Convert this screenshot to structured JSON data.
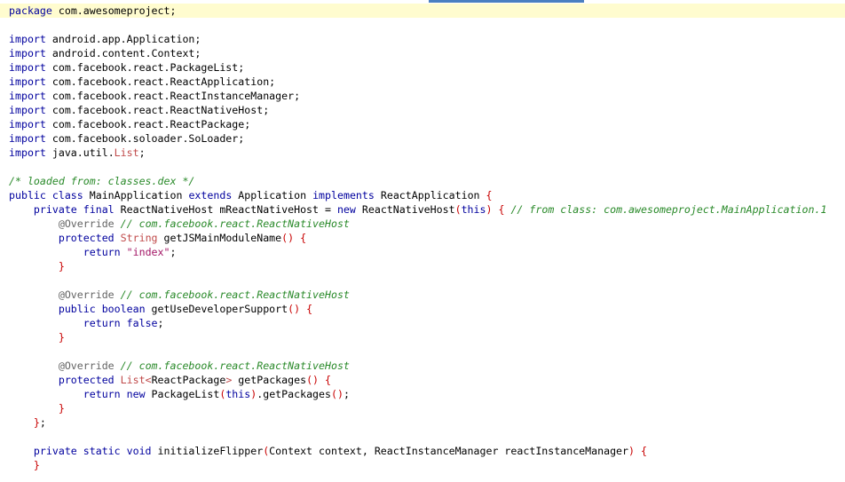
{
  "editor": {
    "lines": [
      {
        "hl": true,
        "tokens": [
          [
            "kw",
            "package"
          ],
          [
            "p",
            " com.awesomeproject;"
          ]
        ]
      },
      {
        "tokens": []
      },
      {
        "tokens": [
          [
            "kw",
            "import"
          ],
          [
            "p",
            " android.app.Application;"
          ]
        ]
      },
      {
        "tokens": [
          [
            "kw",
            "import"
          ],
          [
            "p",
            " android.content.Context;"
          ]
        ]
      },
      {
        "tokens": [
          [
            "kw",
            "import"
          ],
          [
            "p",
            " com.facebook.react.PackageList;"
          ]
        ]
      },
      {
        "tokens": [
          [
            "kw",
            "import"
          ],
          [
            "p",
            " com.facebook.react.ReactApplication;"
          ]
        ]
      },
      {
        "tokens": [
          [
            "kw",
            "import"
          ],
          [
            "p",
            " com.facebook.react.ReactInstanceManager;"
          ]
        ]
      },
      {
        "tokens": [
          [
            "kw",
            "import"
          ],
          [
            "p",
            " com.facebook.react.ReactNativeHost;"
          ]
        ]
      },
      {
        "tokens": [
          [
            "kw",
            "import"
          ],
          [
            "p",
            " com.facebook.react.ReactPackage;"
          ]
        ]
      },
      {
        "tokens": [
          [
            "kw",
            "import"
          ],
          [
            "p",
            " com.facebook.soloader.SoLoader;"
          ]
        ]
      },
      {
        "tokens": [
          [
            "kw",
            "import"
          ],
          [
            "p",
            " java.util."
          ],
          [
            "ty",
            "List"
          ],
          [
            "p",
            ";"
          ]
        ]
      },
      {
        "tokens": []
      },
      {
        "tokens": [
          [
            "cm",
            "/* loaded from: classes.dex */"
          ]
        ]
      },
      {
        "tokens": [
          [
            "kw",
            "public class"
          ],
          [
            "p",
            " MainApplication "
          ],
          [
            "kw",
            "extends"
          ],
          [
            "p",
            " Application "
          ],
          [
            "kw",
            "implements"
          ],
          [
            "p",
            " ReactApplication "
          ],
          [
            "br",
            "{"
          ]
        ]
      },
      {
        "tokens": [
          [
            "p",
            "    "
          ],
          [
            "kw",
            "private final"
          ],
          [
            "p",
            " ReactNativeHost mReactNativeHost = "
          ],
          [
            "kw",
            "new"
          ],
          [
            "p",
            " ReactNativeHost"
          ],
          [
            "br",
            "("
          ],
          [
            "kw",
            "this"
          ],
          [
            "br",
            ")"
          ],
          [
            "p",
            " "
          ],
          [
            "br",
            "{"
          ],
          [
            "p",
            " "
          ],
          [
            "cm",
            "// from class: com.awesomeproject.MainApplication.1"
          ]
        ]
      },
      {
        "tokens": [
          [
            "p",
            "        "
          ],
          [
            "an",
            "@Override"
          ],
          [
            "p",
            " "
          ],
          [
            "cm",
            "// com.facebook.react.ReactNativeHost"
          ]
        ]
      },
      {
        "tokens": [
          [
            "p",
            "        "
          ],
          [
            "kw",
            "protected"
          ],
          [
            "p",
            " "
          ],
          [
            "ty",
            "String"
          ],
          [
            "p",
            " getJSMainModuleName"
          ],
          [
            "br",
            "()"
          ],
          [
            "p",
            " "
          ],
          [
            "br",
            "{"
          ]
        ]
      },
      {
        "tokens": [
          [
            "p",
            "            "
          ],
          [
            "kw",
            "return"
          ],
          [
            "p",
            " "
          ],
          [
            "st",
            "\"index\""
          ],
          [
            "p",
            ";"
          ]
        ]
      },
      {
        "tokens": [
          [
            "p",
            "        "
          ],
          [
            "br",
            "}"
          ]
        ]
      },
      {
        "tokens": []
      },
      {
        "tokens": [
          [
            "p",
            "        "
          ],
          [
            "an",
            "@Override"
          ],
          [
            "p",
            " "
          ],
          [
            "cm",
            "// com.facebook.react.ReactNativeHost"
          ]
        ]
      },
      {
        "tokens": [
          [
            "p",
            "        "
          ],
          [
            "kw",
            "public boolean"
          ],
          [
            "p",
            " getUseDeveloperSupport"
          ],
          [
            "br",
            "()"
          ],
          [
            "p",
            " "
          ],
          [
            "br",
            "{"
          ]
        ]
      },
      {
        "tokens": [
          [
            "p",
            "            "
          ],
          [
            "kw",
            "return false"
          ],
          [
            "p",
            ";"
          ]
        ]
      },
      {
        "tokens": [
          [
            "p",
            "        "
          ],
          [
            "br",
            "}"
          ]
        ]
      },
      {
        "tokens": []
      },
      {
        "tokens": [
          [
            "p",
            "        "
          ],
          [
            "an",
            "@Override"
          ],
          [
            "p",
            " "
          ],
          [
            "cm",
            "// com.facebook.react.ReactNativeHost"
          ]
        ]
      },
      {
        "tokens": [
          [
            "p",
            "        "
          ],
          [
            "kw",
            "protected"
          ],
          [
            "p",
            " "
          ],
          [
            "ty",
            "List"
          ],
          [
            "ge",
            "<"
          ],
          [
            "p",
            "ReactPackage"
          ],
          [
            "ge",
            ">"
          ],
          [
            "p",
            " getPackages"
          ],
          [
            "br",
            "()"
          ],
          [
            "p",
            " "
          ],
          [
            "br",
            "{"
          ]
        ]
      },
      {
        "tokens": [
          [
            "p",
            "            "
          ],
          [
            "kw",
            "return new"
          ],
          [
            "p",
            " PackageList"
          ],
          [
            "br",
            "("
          ],
          [
            "kw",
            "this"
          ],
          [
            "br",
            ")"
          ],
          [
            "p",
            ".getPackages"
          ],
          [
            "br",
            "()"
          ],
          [
            "p",
            ";"
          ]
        ]
      },
      {
        "tokens": [
          [
            "p",
            "        "
          ],
          [
            "br",
            "}"
          ]
        ]
      },
      {
        "tokens": [
          [
            "p",
            "    "
          ],
          [
            "br",
            "}"
          ],
          [
            "p",
            ";"
          ]
        ]
      },
      {
        "tokens": []
      },
      {
        "tokens": [
          [
            "p",
            "    "
          ],
          [
            "kw",
            "private static void"
          ],
          [
            "p",
            " initializeFlipper"
          ],
          [
            "br",
            "("
          ],
          [
            "p",
            "Context context, ReactInstanceManager reactInstanceManager"
          ],
          [
            "br",
            ")"
          ],
          [
            "p",
            " "
          ],
          [
            "br",
            "{"
          ]
        ]
      },
      {
        "tokens": [
          [
            "p",
            "    "
          ],
          [
            "br",
            "}"
          ]
        ]
      }
    ]
  }
}
